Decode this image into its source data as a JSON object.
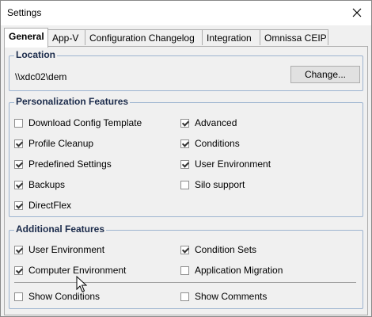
{
  "window": {
    "title": "Settings"
  },
  "tabs": [
    {
      "label": "General",
      "active": true
    },
    {
      "label": "App-V",
      "active": false
    },
    {
      "label": "Configuration Changelog",
      "active": false
    },
    {
      "label": "Integration",
      "active": false
    },
    {
      "label": "Omnissa CEIP",
      "active": false
    }
  ],
  "location": {
    "title": "Location",
    "path": "\\\\xdc02\\dem",
    "change_label": "Change..."
  },
  "personalization": {
    "title": "Personalization Features",
    "items": [
      {
        "label": "Download Config Template",
        "checked": false
      },
      {
        "label": "Advanced",
        "checked": true
      },
      {
        "label": "Profile Cleanup",
        "checked": true
      },
      {
        "label": "Conditions",
        "checked": true
      },
      {
        "label": "Predefined Settings",
        "checked": true
      },
      {
        "label": "User Environment",
        "checked": true
      },
      {
        "label": "Backups",
        "checked": true
      },
      {
        "label": "Silo support",
        "checked": false
      },
      {
        "label": "DirectFlex",
        "checked": true
      }
    ]
  },
  "additional": {
    "title": "Additional Features",
    "items": [
      {
        "label": "User Environment",
        "checked": true
      },
      {
        "label": "Condition Sets",
        "checked": true
      },
      {
        "label": "Computer Environment",
        "checked": true
      },
      {
        "label": "Application Migration",
        "checked": false
      },
      {
        "label": "Show Conditions",
        "checked": false
      },
      {
        "label": "Show Comments",
        "checked": false
      }
    ]
  },
  "icons": {
    "close": "close-icon",
    "cursor": "mouse-pointer-icon"
  }
}
